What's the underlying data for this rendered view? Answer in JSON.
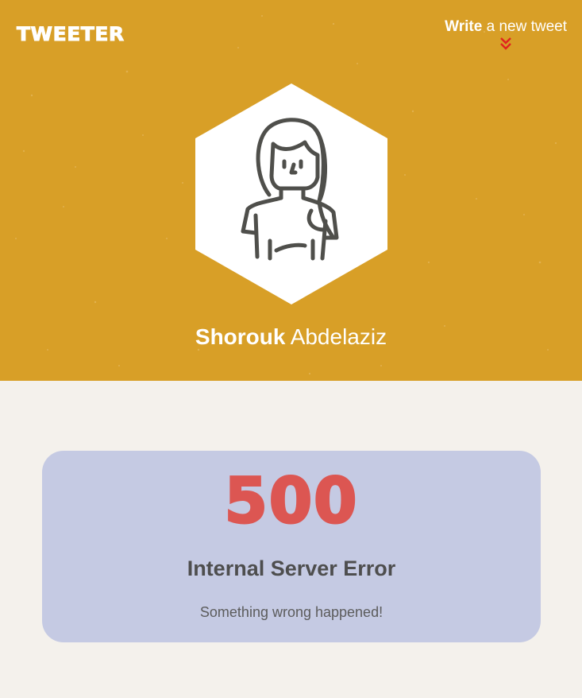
{
  "header": {
    "logo": "TWEETER",
    "compose": {
      "bold": "Write",
      "rest": " a new tweet",
      "icon": "chevron-double-down-icon",
      "icon_color": "#e0231f"
    },
    "user": {
      "first": "Shorouk",
      "last": " Abdelaziz"
    },
    "avatar_icon": "woman-avatar-icon",
    "background_color": "#d89f27"
  },
  "error": {
    "code": "500",
    "title": "Internal Server Error",
    "message": "Something wrong happened!",
    "code_color": "#dc5652",
    "card_color": "#c5cae3"
  }
}
